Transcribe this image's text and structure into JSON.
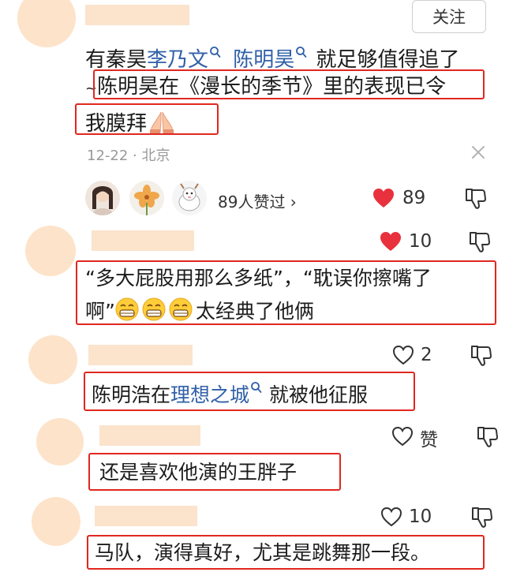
{
  "comments": [
    {
      "follow_label": "关注",
      "pre": "有秦昊",
      "link1": "李乃文",
      "link2": "陈明昊",
      "post": "就足够值得追了",
      "line2_lead": "~",
      "line2": "陈明昊在《漫长的季节》里的表现已令",
      "line3": "我膜拜",
      "meta_text": "12-22 · 北京",
      "likers_text": "89人赞过 ›",
      "likes": "89"
    },
    {
      "likes": "10",
      "line1": "“多大屁股用那么多纸”，“耽误你擦嘴了",
      "line2_pre": "啊”",
      "line2_post": "太经典了他俩"
    },
    {
      "likes": "2",
      "pre": "陈明浩在",
      "link": "理想之城",
      "post": "就被他征服"
    },
    {
      "likes": "赞",
      "text": "还是喜欢他演的王胖子"
    },
    {
      "likes": "10",
      "text": "马队，演得真好，尤其是跳舞那一段。"
    }
  ],
  "colors": {
    "highlight_box": "#e0271f",
    "link": "#3060a8",
    "liked_heart": "#e8313c",
    "avatar_placeholder": "#fde3c9"
  },
  "icons": [
    "search-mini-icon",
    "praying-hands-icon",
    "close-icon",
    "heart-icon",
    "dislike-icon",
    "grinning-face-icon"
  ]
}
